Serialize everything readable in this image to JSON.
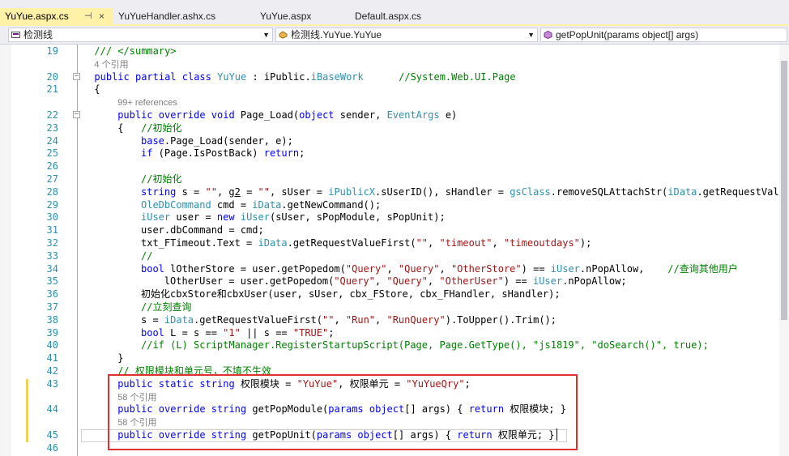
{
  "tabs": [
    {
      "label": "YuYue.aspx.cs",
      "active": true,
      "pin": "⊣",
      "close": "×"
    },
    {
      "label": "YuYueHandler.ashx.cs",
      "active": false
    },
    {
      "label": "YuYue.aspx",
      "active": false
    },
    {
      "label": "Default.aspx.cs",
      "active": false
    }
  ],
  "navbar": {
    "project": "检测线",
    "class": "检测线.YuYue.YuYue",
    "member": "getPopUnit(params object[] args)"
  },
  "editor": {
    "lines": [
      {
        "n": "19",
        "fold": "",
        "indent": 2,
        "html": "<span class='cm'>/// &lt;/summary&gt;</span>"
      },
      {
        "n": "",
        "fold": "",
        "indent": 2,
        "html": "<span class='ref'>4 个引用</span>"
      },
      {
        "n": "20",
        "fold": "−",
        "indent": 2,
        "html": "<span class='kw'>public partial class</span> <span class='ty'>YuYue</span> : iPublic.<span class='ty'>iBaseWork</span>      <span class='cm'>//System.Web.UI.Page</span>"
      },
      {
        "n": "21",
        "fold": "",
        "indent": 2,
        "html": "{"
      },
      {
        "n": "",
        "fold": "",
        "indent": 6,
        "html": "<span class='ref'>99+ references</span>"
      },
      {
        "n": "22",
        "fold": "−",
        "indent": 6,
        "html": "<span class='kw'>public override void</span> Page_Load(<span class='kw'>object</span> sender, <span class='ty'>EventArgs</span> e)"
      },
      {
        "n": "23",
        "fold": "",
        "indent": 6,
        "html": "{   <span class='cm'>//初始化</span>"
      },
      {
        "n": "24",
        "fold": "",
        "indent": 10,
        "html": "<span class='kw'>base</span>.Page_Load(sender, e);"
      },
      {
        "n": "25",
        "fold": "",
        "indent": 10,
        "html": "<span class='kw'>if</span> (Page.IsPostBack) <span class='kw'>return</span>;"
      },
      {
        "n": "26",
        "fold": "",
        "indent": 10,
        "html": ""
      },
      {
        "n": "27",
        "fold": "",
        "indent": 10,
        "html": "<span class='cm'>//初始化</span>"
      },
      {
        "n": "28",
        "fold": "",
        "indent": 10,
        "html": "<span class='kw'>string</span> s = <span class='str'>\"\"</span>, <span style='text-decoration:underline'>g2</span> = <span class='str'>\"\"</span>, sUser = <span class='ty'>iPublicX</span>.sUserID(), sHandler = <span class='ty'>gsClass</span>.removeSQLAttachStr(<span class='ty'>iData</span>.getRequestValueF"
      },
      {
        "n": "29",
        "fold": "",
        "indent": 10,
        "html": "<span class='ty'>OleDbCommand</span> cmd = <span class='ty'>iData</span>.getNewCommand();"
      },
      {
        "n": "30",
        "fold": "",
        "indent": 10,
        "html": "<span class='ty'>iUser</span> user = <span class='kw'>new</span> <span class='ty'>iUser</span>(sUser, sPopModule, sPopUnit);"
      },
      {
        "n": "31",
        "fold": "",
        "indent": 10,
        "html": "user.dbCommand = cmd;"
      },
      {
        "n": "32",
        "fold": "",
        "indent": 10,
        "html": "txt_FTimeout.Text = <span class='ty'>iData</span>.getRequestValueFirst(<span class='str'>\"\"</span>, <span class='str'>\"timeout\"</span>, <span class='str'>\"timeoutdays\"</span>);"
      },
      {
        "n": "33",
        "fold": "",
        "indent": 10,
        "html": "<span class='cm'>//</span>"
      },
      {
        "n": "34",
        "fold": "",
        "indent": 10,
        "html": "<span class='kw'>bool</span> lOtherStore = user.getPopedom(<span class='str'>\"Query\"</span>, <span class='str'>\"Query\"</span>, <span class='str'>\"OtherStore\"</span>) == <span class='ty'>iUser</span>.nPopAllow,    <span class='cm'>//查询其他用户</span>"
      },
      {
        "n": "35",
        "fold": "",
        "indent": 14,
        "html": "lOtherUser = user.getPopedom(<span class='str'>\"Query\"</span>, <span class='str'>\"Query\"</span>, <span class='str'>\"OtherUser\"</span>) == <span class='ty'>iUser</span>.nPopAllow;"
      },
      {
        "n": "36",
        "fold": "",
        "indent": 10,
        "html": "初始化cbxStore和cbxUser(user, sUser, cbx_FStore, cbx_FHandler, sHandler);"
      },
      {
        "n": "37",
        "fold": "",
        "indent": 10,
        "html": "<span class='cm'>//立刻查询</span>"
      },
      {
        "n": "38",
        "fold": "",
        "indent": 10,
        "html": "s = <span class='ty'>iData</span>.getRequestValueFirst(<span class='str'>\"\"</span>, <span class='str'>\"Run\"</span>, <span class='str'>\"RunQuery\"</span>).ToUpper().Trim();"
      },
      {
        "n": "39",
        "fold": "",
        "indent": 10,
        "html": "<span class='kw'>bool</span> L = s == <span class='str'>\"1\"</span> || s == <span class='str'>\"TRUE\"</span>;"
      },
      {
        "n": "40",
        "fold": "",
        "indent": 10,
        "html": "<span class='cm'>//if (L) ScriptManager.RegisterStartupScript(Page, Page.GetType(), \"js1819\", \"doSearch()\", true);</span>"
      },
      {
        "n": "41",
        "fold": "",
        "indent": 6,
        "html": "}"
      },
      {
        "n": "42",
        "fold": "",
        "indent": 6,
        "html": "<span class='cm'>// 权限模块和单元号，不填不生效</span>"
      },
      {
        "n": "43",
        "fold": "",
        "indent": 6,
        "html": "<span class='kw'>public static string</span> 权限模块 = <span class='str'>\"YuYue\"</span>, 权限单元 = <span class='str'>\"YuYueQry\"</span>;"
      },
      {
        "n": "",
        "fold": "",
        "indent": 6,
        "html": "<span class='ref'>58 个引用</span>"
      },
      {
        "n": "44",
        "fold": "",
        "indent": 6,
        "html": "<span class='kw'>public override string</span> getPopModule(<span class='kw'>params object</span>[] args) { <span class='kw'>return</span> 权限模块; }"
      },
      {
        "n": "",
        "fold": "",
        "indent": 6,
        "html": "<span class='ref'>58 个引用</span>"
      },
      {
        "n": "45",
        "fold": "",
        "indent": 6,
        "html": "<span class='kw'>public override string</span> getPopUnit(<span class='kw'>params object</span>[] args) { <span class='kw'>return</span> 权限单元; }"
      },
      {
        "n": "46",
        "fold": "",
        "indent": 2,
        "html": ""
      }
    ]
  }
}
